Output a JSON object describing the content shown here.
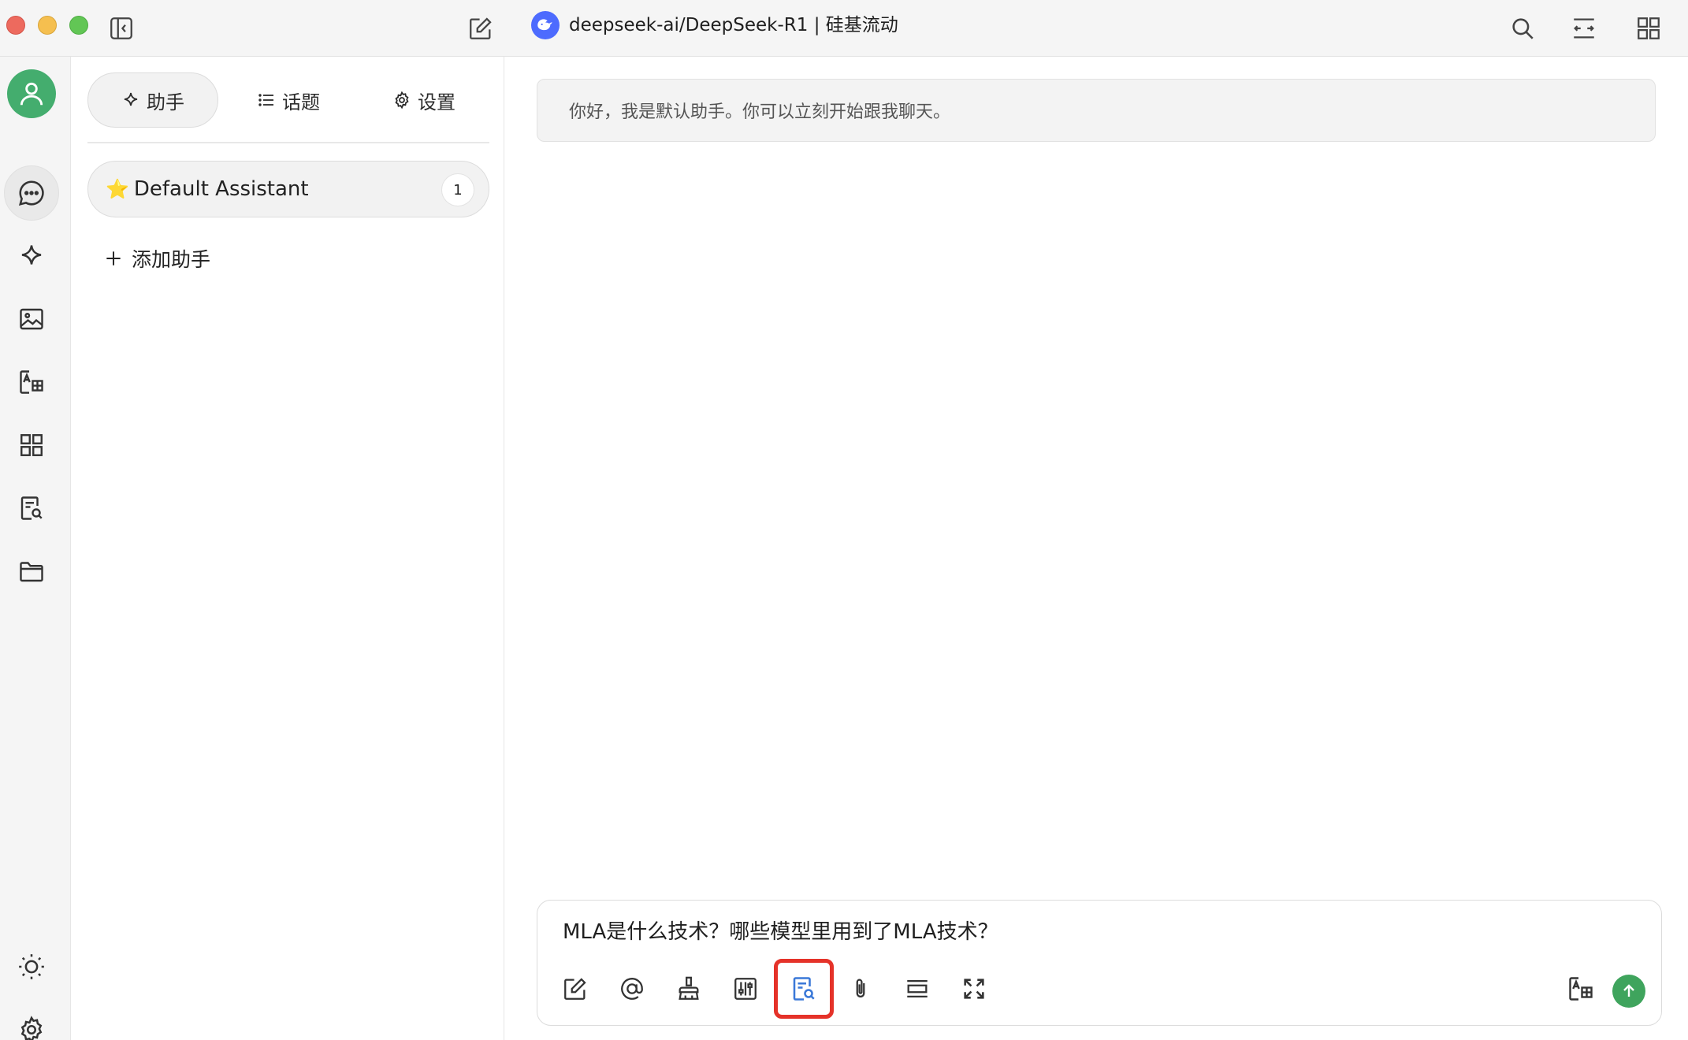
{
  "window": {
    "title": "deepseek-ai/DeepSeek-R1 | 硅基流动"
  },
  "panel": {
    "tabs": [
      {
        "label": "助手",
        "icon": "sparkle-icon"
      },
      {
        "label": "话题",
        "icon": "list-icon"
      },
      {
        "label": "设置",
        "icon": "gear-icon"
      }
    ],
    "assistant": {
      "emoji": "⭐",
      "name": "Default Assistant",
      "count": "1"
    },
    "add_label": "添加助手"
  },
  "chat": {
    "greeting": "你好，我是默认助手。你可以立刻开始跟我聊天。",
    "input_text": "MLA是什么技术？哪些模型里用到了MLA技术？"
  },
  "colors": {
    "accent": "#44ad6e",
    "highlight": "#e53229",
    "model_logo": "#4d6bfe"
  }
}
